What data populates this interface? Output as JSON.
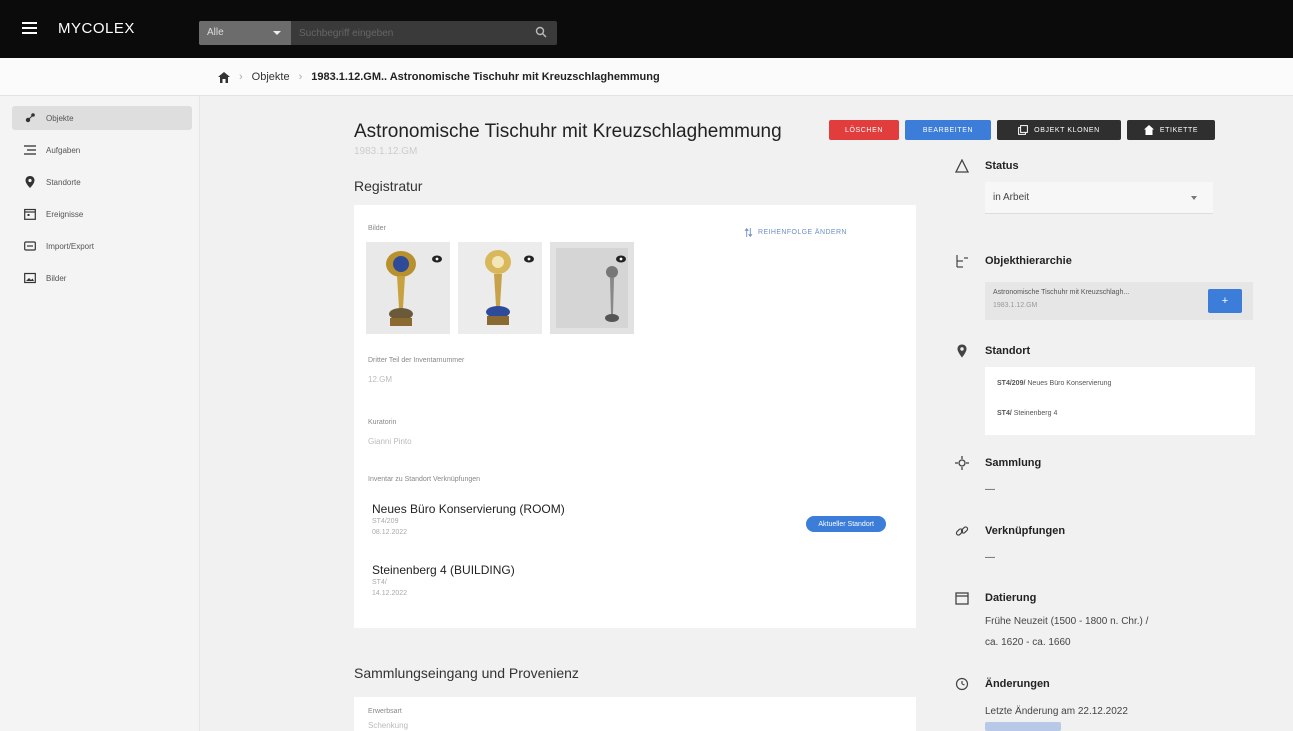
{
  "app": {
    "brand": "MYCOLEX"
  },
  "search": {
    "select_label": "Alle",
    "placeholder": "Suchbegriff eingeben"
  },
  "breadcrumb": {
    "items": [
      "Objekte",
      "1983.1.12.GM.. Astronomische Tischuhr mit Kreuzschlaghemmung"
    ]
  },
  "sidebar": {
    "items": [
      {
        "label": "Objekte",
        "icon": "objects-icon"
      },
      {
        "label": "Aufgaben",
        "icon": "tasks-icon"
      },
      {
        "label": "Standorte",
        "icon": "location-icon"
      },
      {
        "label": "Ereignisse",
        "icon": "calendar-icon"
      },
      {
        "label": "Import/Export",
        "icon": "import-export-icon"
      },
      {
        "label": "Bilder",
        "icon": "images-icon"
      }
    ]
  },
  "header": {
    "title": "Astronomische Tischuhr mit Kreuzschlaghemmung",
    "subtitle": "1983.1.12.GM",
    "buttons": {
      "delete": "LÖSCHEN",
      "edit": "BEARBEITEN",
      "clone": "OBJEKT KLONEN",
      "label": "ETIKETTE"
    }
  },
  "registratur": {
    "title": "Registratur",
    "images_label": "Bilder",
    "manage_link": "REIHENFOLGE ÄNDERN",
    "fields": [
      {
        "label": "Dritter Teil der Inventarnummer",
        "value": "12.GM"
      },
      {
        "label": "Kuratorin",
        "value": "Gianni Pinto"
      }
    ],
    "locations_label": "Inventar zu Standort Verknüpfungen",
    "locations": [
      {
        "title": "Neues Büro Konservierung (ROOM)",
        "code": "ST4/209",
        "date": "08.12.2022",
        "button": "Aktueller Standort"
      },
      {
        "title": "Steinenberg 4 (BUILDING)",
        "code": "ST4/",
        "date": "14.12.2022"
      }
    ]
  },
  "provenienz": {
    "title": "Sammlungseingang und Provenienz",
    "label": "Erwerbsart",
    "value": "Schenkung"
  },
  "right": {
    "status": {
      "title": "Status",
      "value": "in Arbeit"
    },
    "hierarchy": {
      "title": "Objekthierarchie",
      "item": "Astronomische Tischuhr mit Kreuzschlagh...",
      "code": "1983.1.12.GM",
      "button": "+"
    },
    "standort": {
      "title": "Standort",
      "items": [
        {
          "code": "ST4/209/",
          "name": "Neues Büro Konservierung"
        },
        {
          "code": "ST4/",
          "name": "Steinenberg 4"
        }
      ]
    },
    "sammlung": {
      "title": "Sammlung",
      "value": "—"
    },
    "verknuepfungen": {
      "title": "Verknüpfungen",
      "value": "—"
    },
    "datierung": {
      "title": "Datierung",
      "line1": "Frühe Neuzeit (1500 - 1800 n. Chr.) /",
      "line2": "ca. 1620 - ca. 1660"
    },
    "aenderungen": {
      "title": "Änderungen",
      "value": "Letzte Änderung am 22.12.2022"
    }
  },
  "colors": {
    "delete": "#e23d3d",
    "edit": "#3b7dd8",
    "dark": "#2f2f2f",
    "accent": "#3b7dd8"
  }
}
